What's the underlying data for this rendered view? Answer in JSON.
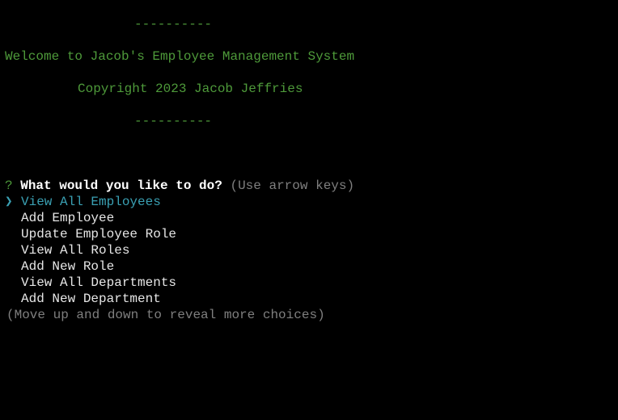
{
  "banner": {
    "divider": "----------",
    "welcome": "Welcome to Jacob's Employee Management System",
    "copyright": "Copyright 2023 Jacob Jeffries"
  },
  "prompt": {
    "marker": "?",
    "question": "What would you like to do?",
    "hint": "(Use arrow keys)",
    "pointer": "❯",
    "selected_index": 0,
    "choices": [
      "View All Employees",
      "Add Employee",
      "Update Employee Role",
      "View All Roles",
      "Add New Role",
      "View All Departments",
      "Add New Department"
    ],
    "footer": "(Move up and down to reveal more choices)"
  },
  "colors": {
    "background": "#000000",
    "banner_green": "#4e9a3a",
    "selected_cyan": "#3aa0b3",
    "hint_gray": "#7f7f7f"
  }
}
